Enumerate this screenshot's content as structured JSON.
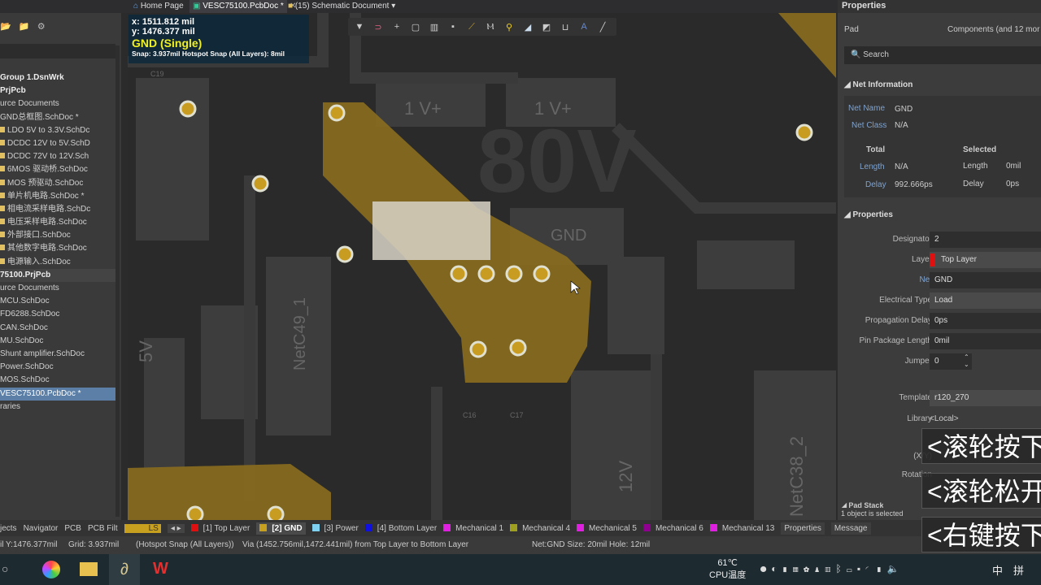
{
  "tabs": [
    {
      "label": "Home Page"
    },
    {
      "label": "VESC75100.PcbDoc *"
    },
    {
      "label": "(15) Schematic Document"
    }
  ],
  "left_panel": {
    "items": [
      {
        "label": "Group 1.DsnWrk",
        "bold": true
      },
      {
        "label": "PrjPcb",
        "bold": true
      },
      {
        "label": "urce Documents"
      },
      {
        "label": "GND总框图.SchDoc *"
      },
      {
        "label": "LDO 5V to 3.3V.SchDc",
        "file": true
      },
      {
        "label": "DCDC 12V to 5V.SchD",
        "file": true
      },
      {
        "label": "DCDC 72V to 12V.Sch",
        "file": true
      },
      {
        "label": "6MOS 驱动桥.SchDoc",
        "file": true
      },
      {
        "label": "MOS 预驱动.SchDoc",
        "file": true
      },
      {
        "label": "单片机电路.SchDoc *",
        "file": true
      },
      {
        "label": "相电流采样电路.SchDc",
        "file": true
      },
      {
        "label": "电压采样电路.SchDoc",
        "file": true
      },
      {
        "label": "外部接口.SchDoc",
        "file": true
      },
      {
        "label": "其他数字电路.SchDoc",
        "file": true
      },
      {
        "label": "电源输入.SchDoc",
        "file": true
      },
      {
        "label": "75100.PrjPcb",
        "bold": true,
        "group": true
      },
      {
        "label": "urce Documents"
      },
      {
        "label": "MCU.SchDoc"
      },
      {
        "label": "FD6288.SchDoc"
      },
      {
        "label": "CAN.SchDoc"
      },
      {
        "label": "MU.SchDoc"
      },
      {
        "label": "Shunt amplifier.SchDoc"
      },
      {
        "label": "Power.SchDoc"
      },
      {
        "label": "MOS.SchDoc"
      },
      {
        "label": "VESC75100.PcbDoc *",
        "selected": true
      },
      {
        "label": "raries"
      }
    ]
  },
  "hud": {
    "x": "x:  1511.812 mil",
    "y": "y:  1476.377 mil",
    "net": "GND (Single)",
    "snap": "Snap: 3.937mil Hotspot Snap (All Layers): 8mil"
  },
  "pcb_labels": {
    "c19": "C19",
    "v1": "1  V+",
    "v2": "1  V+",
    "big": "80V",
    "netc49": "NetC49_1",
    "v5": "5V",
    "v12": "12V",
    "netc38": "NetC38_2",
    "c16": "C16",
    "c17": "C17",
    "gnd": "GND"
  },
  "properties": {
    "title": "Properties",
    "type": "Pad",
    "filter": "Components (and 12 mor",
    "search_placeholder": "Search",
    "net_info": {
      "header": "Net Information",
      "net_name_label": "Net Name",
      "net_name": "GND",
      "net_class_label": "Net Class",
      "net_class": "N/A",
      "total": "Total",
      "selected": "Selected",
      "length_label": "Length",
      "length_total": "N/A",
      "length_sel": "0mil",
      "delay_label": "Delay",
      "delay_total": "992.666ps",
      "delay_sel": "0ps"
    },
    "props_header": "Properties",
    "fields": [
      {
        "label": "Designator",
        "value": "2"
      },
      {
        "label": "Layer",
        "value": "Top Layer"
      },
      {
        "label": "Net",
        "value": "GND"
      },
      {
        "label": "Electrical Type",
        "value": "Load"
      },
      {
        "label": "Propagation Delay",
        "value": "0ps"
      },
      {
        "label": "Pin Package Length",
        "value": "0mil"
      },
      {
        "label": "Jumper",
        "value": "0"
      }
    ],
    "template_label": "Template",
    "template": "r120_270",
    "library_label": "Library",
    "library": "<Local>",
    "xy_label": "(X/Y)",
    "rotation_label": "Rotation",
    "pad_stack": "Pad Stack",
    "selection": "1 object is selected"
  },
  "subtitles": [
    "<滚轮按下",
    "<滚轮松开",
    "<右键按下"
  ],
  "layer_bar": {
    "panels": [
      "jects",
      "Navigator",
      "PCB",
      "PCB Filt"
    ],
    "ls": "LS",
    "layers": [
      {
        "name": "[1] Top Layer",
        "color": "#e01010"
      },
      {
        "name": "[2] GND",
        "color": "#c8a020",
        "active": true
      },
      {
        "name": "[3] Power",
        "color": "#80d0f0"
      },
      {
        "name": "[4] Bottom Layer",
        "color": "#1010e0"
      },
      {
        "name": "Mechanical 1",
        "color": "#e020e0"
      },
      {
        "name": "Mechanical 4",
        "color": "#a0a020"
      },
      {
        "name": "Mechanical 5",
        "color": "#e020e0"
      },
      {
        "name": "Mechanical 6",
        "color": "#900090"
      },
      {
        "name": "Mechanical 13",
        "color": "#e020e0"
      }
    ],
    "right_tabs": [
      "Properties",
      "Message"
    ]
  },
  "status": {
    "coords": "il Y:1476.377mil",
    "grid": "Grid: 3.937mil",
    "snap": "(Hotspot Snap (All Layers))",
    "via": "Via (1452.756mil,1472.441mil) from Top Layer to Bottom Layer",
    "net": "Net:GND Size: 20mil Hole: 12mil"
  },
  "taskbar": {
    "temp": "61℃",
    "temp_label": "CPU温度",
    "ime1": "中",
    "ime2": "拼"
  }
}
